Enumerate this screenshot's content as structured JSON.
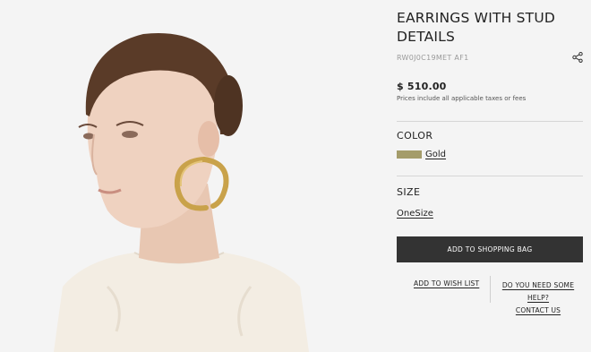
{
  "product": {
    "title": "EARRINGS WITH STUD DETAILS",
    "sku": "RW0J0C19MET AF1",
    "price": "$ 510.00",
    "tax_note": "Prices include all applicable taxes or fees"
  },
  "color": {
    "label": "COLOR",
    "selected": "Gold",
    "swatch_hex": "#a49c6a"
  },
  "size": {
    "label": "SIZE",
    "selected": "OneSize"
  },
  "actions": {
    "add_to_bag": "ADD TO SHOPPING BAG",
    "wish_list": "ADD TO WISH LIST",
    "help_question": "DO YOU NEED SOME HELP?",
    "contact": "CONTACT US"
  },
  "icons": {
    "share": "share-icon"
  },
  "colors": {
    "background": "#f4f4f4",
    "button": "#333333"
  }
}
